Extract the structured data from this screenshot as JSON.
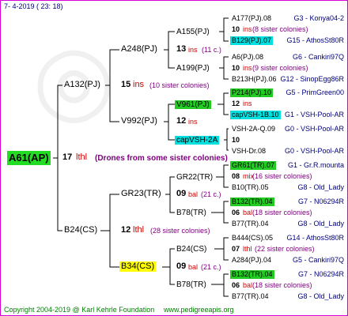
{
  "header": {
    "date": "7-  4-2019 ( 23: 18)"
  },
  "footer": {
    "copyright": "Copyright 2004-2019 @ Karl Kehrle Foundation",
    "url": "www.pedigreeapis.org"
  },
  "root": {
    "id": "A61(AP)",
    "gen": "17",
    "tag": "lthl",
    "note": "(Drones from some sister colonies)"
  },
  "g1": {
    "sire": {
      "id": "A132(PJ)",
      "count": "15",
      "unit": "ins",
      "note": "(10 sister colonies)"
    },
    "dam": {
      "id": "B24(CS)",
      "count": "12",
      "unit": "lthl",
      "note": "(28 sister colonies)"
    }
  },
  "g2": [
    {
      "id": "A248(PJ)",
      "count": "13",
      "unit": "ins",
      "note": "(11 c.)"
    },
    {
      "id": "V992(PJ)",
      "count": "12",
      "unit": "ins",
      "note": ""
    },
    {
      "id": "GR23(TR)",
      "count": "09",
      "unit": "bal",
      "note": "(21 c.)"
    },
    {
      "id": "B34(CS)",
      "count": "09",
      "unit": "bal",
      "note": "(21 c.)"
    }
  ],
  "g3": [
    {
      "id": "A155(PJ)"
    },
    {
      "id": "A199(PJ)"
    },
    {
      "id": "V961(PJ)"
    },
    {
      "id": "capVSH-2A"
    },
    {
      "id": "GR22(TR)"
    },
    {
      "id": "B78(TR)"
    },
    {
      "id": "B24(CS)"
    },
    {
      "id": "B78(TR)"
    }
  ],
  "g4": [
    {
      "id": "A177(PJ).08",
      "info": "G3 - Konya04-2",
      "mid": ""
    },
    {
      "id": "10",
      "info": "",
      "mid": "ins",
      "note": "(8 sister colonies)"
    },
    {
      "id": "B129(PJ).07",
      "info": "G15 - AthosSt80R",
      "mid": ""
    },
    {
      "id": "A6(PJ).08",
      "info": "G6 - Cankiri97Q",
      "mid": ""
    },
    {
      "id": "10",
      "info": "",
      "mid": "ins",
      "note": "(9 sister colonies)"
    },
    {
      "id": "B213H(PJ).06",
      "info": "G12 - SinopEgg86R",
      "mid": ""
    },
    {
      "id": "P214(PJ).10",
      "info": "G5 - PrimGreen00",
      "mid": ""
    },
    {
      "id": "12",
      "info": "",
      "mid": "ins",
      "note": ""
    },
    {
      "id": "capVSH-1B.10",
      "info": "G1 - VSH-Pool-AR",
      "mid": ""
    },
    {
      "id": "VSH-2A-Q.09",
      "info": "G0 - VSH-Pool-AR",
      "mid": ""
    },
    {
      "id": "10",
      "info": "",
      "mid": "",
      "note": ""
    },
    {
      "id": "VSH-Dr.08",
      "info": "G0 - VSH-Pool-AR",
      "mid": ""
    },
    {
      "id": "GR61(TR).07",
      "info": "G1 - Gr.R.mounta",
      "mid": ""
    },
    {
      "id": "08",
      "info": "",
      "mid": "mix",
      "note": "(16 sister colonies)"
    },
    {
      "id": "B10(TR).05",
      "info": "G8 - Old_Lady",
      "mid": ""
    },
    {
      "id": "B132(TR).04",
      "info": "G7 - N06294R",
      "mid": ""
    },
    {
      "id": "06",
      "info": "",
      "mid": "bal",
      "note": "(18 sister colonies)"
    },
    {
      "id": "B77(TR).04",
      "info": "G8 - Old_Lady",
      "mid": ""
    },
    {
      "id": "B444(CS).05",
      "info": "G14 - AthosSt80R",
      "mid": ""
    },
    {
      "id": "07",
      "info": "",
      "mid": "lthl",
      "note": "(22 sister colonies)"
    },
    {
      "id": "A284(PJ).04",
      "info": "G5 - Cankiri97Q",
      "mid": ""
    },
    {
      "id": "B132(TR).04",
      "info": "G7 - N06294R",
      "mid": ""
    },
    {
      "id": "06",
      "info": "",
      "mid": "bal",
      "note": "(18 sister colonies)"
    },
    {
      "id": "B77(TR).04",
      "info": "G8 - Old_Lady",
      "mid": ""
    }
  ],
  "colors": {
    "frame": "#d400d4",
    "green": "#00d000",
    "cyan": "#00e0e0",
    "yellow": "#ffff00"
  }
}
